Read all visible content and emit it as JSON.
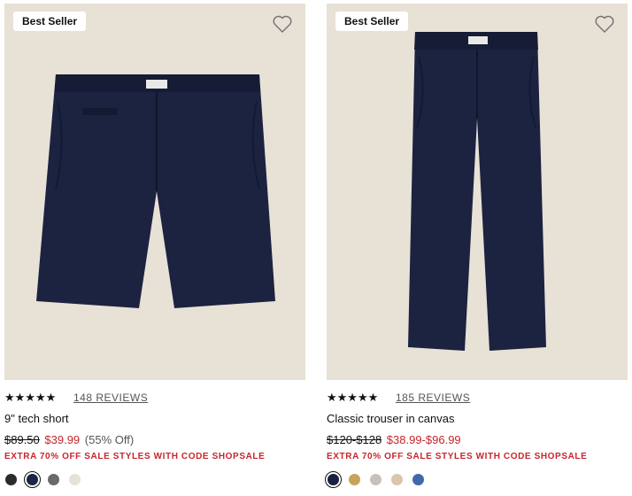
{
  "products": [
    {
      "badge": "Best Seller",
      "stars": "★★★★★",
      "reviews": "148 REVIEWS",
      "name": "9\" tech short",
      "original_price": "$89.50",
      "sale_price": "$39.99",
      "discount": "(55% Off)",
      "promo": "EXTRA 70% OFF SALE STYLES WITH CODE SHOPSALE",
      "swatches": [
        {
          "color": "#2b2b2b",
          "selected": false
        },
        {
          "color": "#1d2545",
          "selected": true
        },
        {
          "color": "#6a6a6a",
          "selected": false
        },
        {
          "color": "#e6e2da",
          "selected": false
        }
      ]
    },
    {
      "badge": "Best Seller",
      "stars": "★★★★★",
      "reviews": "185 REVIEWS",
      "name": "Classic trouser in canvas",
      "original_price": "$120-$128",
      "sale_price": "$38.99-$96.99",
      "discount": "",
      "promo": "EXTRA 70% OFF SALE STYLES WITH CODE SHOPSALE",
      "swatches": [
        {
          "color": "#1b2140",
          "selected": true
        },
        {
          "color": "#c9a35c",
          "selected": false
        },
        {
          "color": "#c8c1ba",
          "selected": false
        },
        {
          "color": "#d9c6ad",
          "selected": false
        },
        {
          "color": "#3e6aa8",
          "selected": false
        }
      ]
    }
  ],
  "colors": {
    "image_bg": "#e8e1d6",
    "sale_red": "#c8252c",
    "garment_navy": "#1c2340"
  }
}
